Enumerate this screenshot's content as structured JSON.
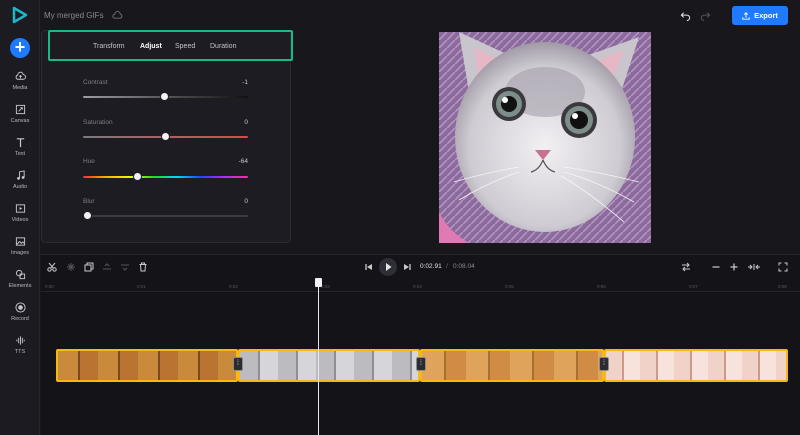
{
  "project": {
    "title": "My merged GIFs"
  },
  "toolbar": {
    "export_label": "Export"
  },
  "sidebar": {
    "items": [
      {
        "label": "Media",
        "icon": "upload-cloud-icon"
      },
      {
        "label": "Canvas",
        "icon": "resize-icon"
      },
      {
        "label": "Text",
        "icon": "text-icon"
      },
      {
        "label": "Audio",
        "icon": "music-note-icon"
      },
      {
        "label": "Videos",
        "icon": "video-icon"
      },
      {
        "label": "Images",
        "icon": "image-icon"
      },
      {
        "label": "Elements",
        "icon": "shapes-icon"
      },
      {
        "label": "Record",
        "icon": "record-icon"
      },
      {
        "label": "TTS",
        "icon": "waveform-icon"
      }
    ]
  },
  "panel": {
    "tabs": [
      {
        "label": "Transform",
        "active": false
      },
      {
        "label": "Adjust",
        "active": true
      },
      {
        "label": "Speed",
        "active": false
      },
      {
        "label": "Duration",
        "active": false
      }
    ],
    "sliders": [
      {
        "label": "Contrast",
        "value": "-1"
      },
      {
        "label": "Saturation",
        "value": "0"
      },
      {
        "label": "Hue",
        "value": "-64"
      },
      {
        "label": "Blur",
        "value": "0"
      }
    ]
  },
  "timeline": {
    "current_time": "0:02.91",
    "separator": "/",
    "total_time": "0:08.04",
    "ruler_ticks": [
      "0:00",
      "0:01",
      "0:02",
      "0:03",
      "0:04",
      "0:05",
      "0:06",
      "0:07",
      "0:08"
    ],
    "clips": [
      {
        "name": "clip-1",
        "frame_color": "#c98a3c"
      },
      {
        "name": "clip-2",
        "frame_color": "#b9b9bd"
      },
      {
        "name": "clip-3",
        "frame_color": "#e0a35c"
      },
      {
        "name": "clip-4",
        "frame_color": "#f0d2c8"
      }
    ]
  },
  "colors": {
    "accent": "#1f7aff",
    "highlight": "#19b985",
    "clip_border": "#f5b915"
  }
}
